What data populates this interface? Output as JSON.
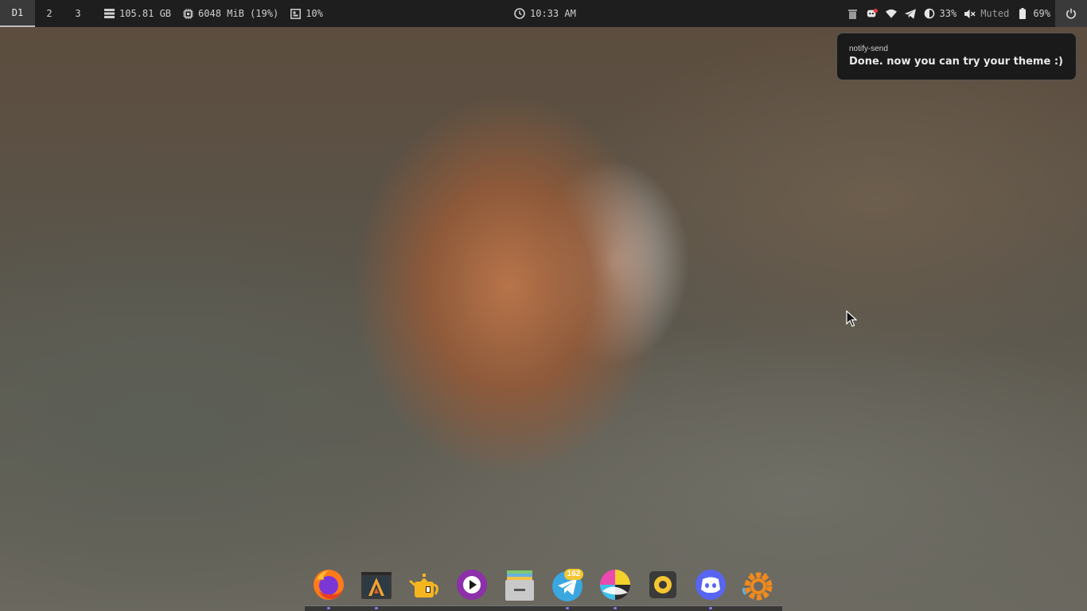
{
  "topbar": {
    "workspaces": [
      {
        "label": "D1",
        "active": true
      },
      {
        "label": "2",
        "active": false
      },
      {
        "label": "3",
        "active": false
      }
    ],
    "disk": {
      "icon": "disk-icon",
      "value": "105.81 GB"
    },
    "memory": {
      "icon": "cpu-chip-icon",
      "value": "6048 MiB (19%)"
    },
    "cpu": {
      "icon": "cpu-icon",
      "value": "10%"
    },
    "clock": {
      "icon": "clock-icon",
      "value": "10:33 AM"
    },
    "tray": {
      "icons": [
        "trash-icon",
        "discord-tray-icon",
        "wifi-icon",
        "telegram-tray-icon"
      ],
      "brightness": {
        "icon": "brightness-icon",
        "value": "33%"
      },
      "volume": {
        "icon": "volume-muted-icon",
        "value": "Muted"
      },
      "battery": {
        "icon": "battery-icon",
        "value": "69%"
      }
    },
    "power_icon": "power-icon"
  },
  "notification": {
    "app": "notify-send",
    "body": "Done. now you can try your theme :)"
  },
  "dock": {
    "apps": [
      {
        "name": "firefox",
        "icon": "firefox-icon",
        "running": true
      },
      {
        "name": "alacritty",
        "icon": "alacritty-icon",
        "running": true
      },
      {
        "name": "teapot",
        "icon": "teapot-icon",
        "running": false
      },
      {
        "name": "media-player",
        "icon": "play-icon",
        "running": false
      },
      {
        "name": "file-manager",
        "icon": "file-manager-icon",
        "running": false
      },
      {
        "name": "telegram",
        "icon": "telegram-icon",
        "running": true,
        "badge": "162"
      },
      {
        "name": "color-picker",
        "icon": "color-picker-icon",
        "running": true
      },
      {
        "name": "music",
        "icon": "music-icon",
        "running": false
      },
      {
        "name": "discord",
        "icon": "discord-icon",
        "running": true
      },
      {
        "name": "xfce-settings",
        "icon": "settings-gear-icon",
        "running": false
      }
    ]
  },
  "colors": {
    "bar_bg": "#1e1e1e",
    "bar_fg": "#cfcfcf",
    "accent_indicator": "#8a7bff"
  }
}
